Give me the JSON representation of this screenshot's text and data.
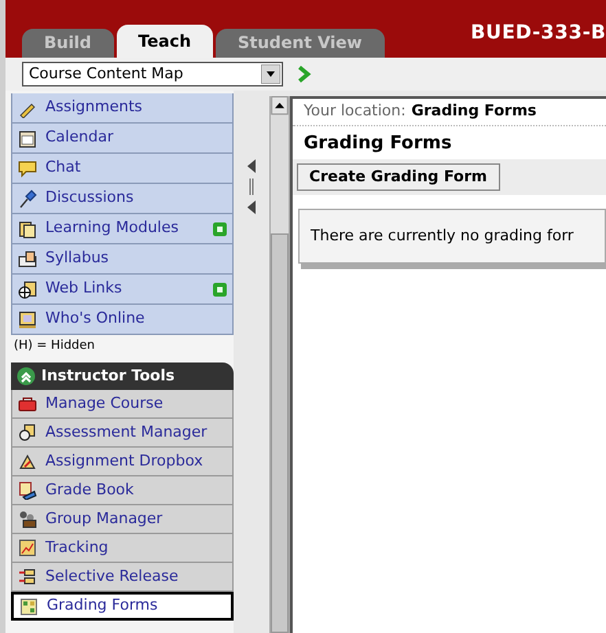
{
  "tabs": [
    {
      "label": "Build",
      "selected": false
    },
    {
      "label": "Teach",
      "selected": true
    },
    {
      "label": "Student View",
      "selected": false
    }
  ],
  "course_title": "BUED-333-B",
  "toolbar": {
    "dropdown_value": "Course Content Map"
  },
  "student_tools": [
    {
      "label": "Assignments",
      "new": false
    },
    {
      "label": "Calendar",
      "new": false
    },
    {
      "label": "Chat",
      "new": false
    },
    {
      "label": "Discussions",
      "new": false
    },
    {
      "label": "Learning Modules",
      "new": true
    },
    {
      "label": "Syllabus",
      "new": false
    },
    {
      "label": "Web Links",
      "new": true
    },
    {
      "label": "Who's Online",
      "new": false
    }
  ],
  "hidden_note": "(H) = Hidden",
  "instructor_tools": {
    "title": "Instructor Tools",
    "expanded": true,
    "items": [
      {
        "label": "Manage Course",
        "selected": false
      },
      {
        "label": "Assessment Manager",
        "selected": false
      },
      {
        "label": "Assignment Dropbox",
        "selected": false
      },
      {
        "label": "Grade Book",
        "selected": false
      },
      {
        "label": "Group Manager",
        "selected": false
      },
      {
        "label": "Tracking",
        "selected": false
      },
      {
        "label": "Selective Release",
        "selected": false
      },
      {
        "label": "Grading Forms",
        "selected": true
      }
    ]
  },
  "content": {
    "location_label": "Your location:",
    "location_value": "Grading Forms",
    "heading": "Grading Forms",
    "create_button": "Create Grading Form",
    "message": "There are currently no grading forr"
  }
}
